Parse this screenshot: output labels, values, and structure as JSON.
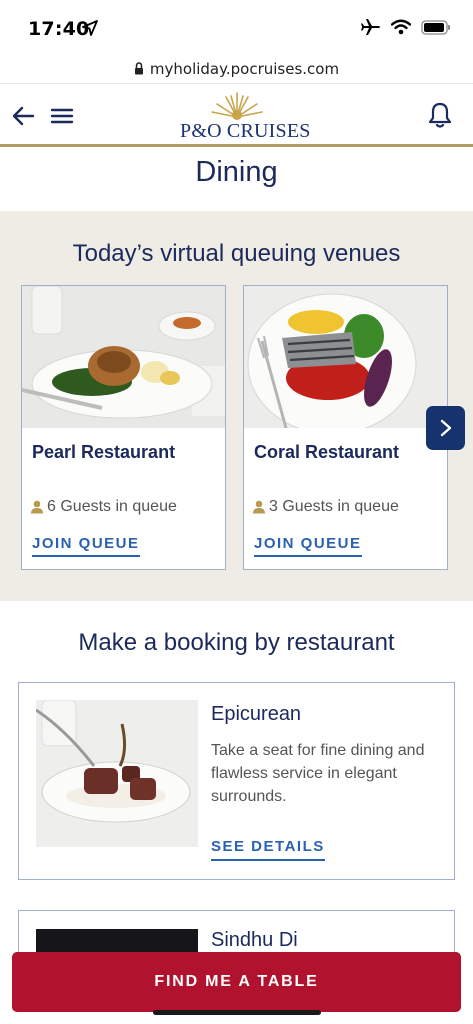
{
  "status_bar": {
    "time": "17:40",
    "icons": [
      "location-arrow-icon",
      "airplane-icon",
      "wifi-icon",
      "battery-icon"
    ]
  },
  "browser": {
    "url": "myholiday.pocruises.com",
    "lock_icon": "lock-icon"
  },
  "nav": {
    "logo_text": "P&O CRUISES",
    "icons": [
      "back-arrow-icon",
      "menu-icon",
      "bell-icon"
    ]
  },
  "page": {
    "title": "Dining"
  },
  "queue": {
    "heading": "Today’s virtual queuing venues",
    "venues": [
      {
        "name": "Pearl Restaurant",
        "guests": "6 Guests in queue",
        "action": "JOIN QUEUE"
      },
      {
        "name": "Coral Restaurant",
        "guests": "3 Guests in queue",
        "action": "JOIN QUEUE"
      }
    ],
    "next_icon": "chevron-right-icon"
  },
  "booking": {
    "heading": "Make a booking by restaurant",
    "restaurants": [
      {
        "name": "Epicurean",
        "description": "Take a seat for fine dining and flawless service in elegant surrounds.",
        "action": "SEE DETAILS"
      },
      {
        "name": "Sindhu Di"
      }
    ]
  },
  "cta": {
    "label": "FIND ME A TABLE"
  },
  "colors": {
    "navy": "#1b2a5b",
    "link_blue": "#2a62b0",
    "gold": "#b29a64",
    "cta_red": "#b1132f",
    "section_bg": "#efece6"
  }
}
